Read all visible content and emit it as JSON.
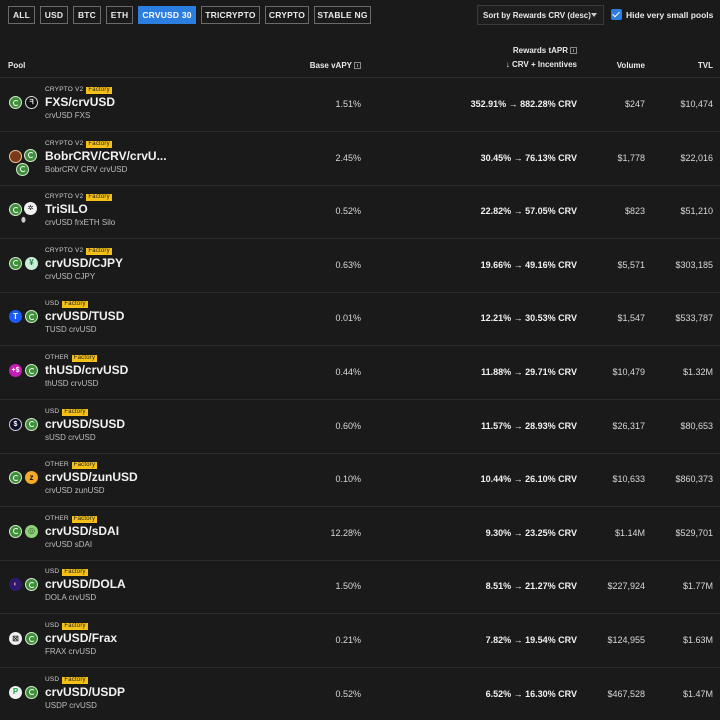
{
  "filters": [
    "ALL",
    "USD",
    "BTC",
    "ETH",
    "CRVUSD 30",
    "TRICRYPTO",
    "CRYPTO",
    "STABLE NG"
  ],
  "active_filter": "CRVUSD 30",
  "sort_label": "Sort by Rewards CRV (desc)",
  "hide_small_label": "Hide very small pools",
  "hide_small_checked": true,
  "headers": {
    "pool": "Pool",
    "base_vapy": "Base vAPY",
    "rewards_title": "Rewards tAPR",
    "rewards_sub": "↓ CRV + Incentives",
    "volume": "Volume",
    "tvl": "TVL"
  },
  "colors": {
    "accent": "#2b7de0",
    "factory_badge": "#f5c118",
    "background": "#1a1a1a"
  },
  "rows": [
    {
      "category": "CRYPTO V2",
      "badge": "Factory",
      "name": "FXS/crvUSD",
      "coins": "crvUSD FXS",
      "icons": [
        "crvusd-icon",
        "fxs-icon"
      ],
      "base_vapy": "1.51%",
      "rewards": "352.91% → 882.28% CRV",
      "volume": "$247",
      "tvl": "$10,474"
    },
    {
      "category": "CRYPTO V2",
      "badge": "Factory",
      "name": "BobrCRV/CRV/crvU...",
      "coins": "BobrCRV CRV crvUSD",
      "icons": [
        "bobrcrv-icon",
        "crv-icon",
        "crvusd-icon"
      ],
      "base_vapy": "2.45%",
      "rewards": "30.45% → 76.13% CRV",
      "volume": "$1,778",
      "tvl": "$22,016"
    },
    {
      "category": "CRYPTO V2",
      "badge": "Factory",
      "name": "TriSILO",
      "coins": "crvUSD frxETH Silo",
      "icons": [
        "crvusd-icon",
        "silo-icon",
        "frxeth-icon"
      ],
      "base_vapy": "0.52%",
      "rewards": "22.82% → 57.05% CRV",
      "volume": "$823",
      "tvl": "$51,210"
    },
    {
      "category": "CRYPTO V2",
      "badge": "Factory",
      "name": "crvUSD/CJPY",
      "coins": "crvUSD CJPY",
      "icons": [
        "crvusd-icon",
        "cjpy-icon"
      ],
      "base_vapy": "0.63%",
      "rewards": "19.66% → 49.16% CRV",
      "volume": "$5,571",
      "tvl": "$303,185"
    },
    {
      "category": "USD",
      "badge": "Factory",
      "name": "crvUSD/TUSD",
      "coins": "TUSD crvUSD",
      "icons": [
        "tusd-icon",
        "crvusd-icon"
      ],
      "base_vapy": "0.01%",
      "rewards": "12.21% → 30.53% CRV",
      "volume": "$1,547",
      "tvl": "$533,787"
    },
    {
      "category": "OTHER",
      "badge": "Factory",
      "name": "thUSD/crvUSD",
      "coins": "thUSD crvUSD",
      "icons": [
        "thusd-icon",
        "crvusd-icon"
      ],
      "base_vapy": "0.44%",
      "rewards": "11.88% → 29.71% CRV",
      "volume": "$10,479",
      "tvl": "$1.32M"
    },
    {
      "category": "USD",
      "badge": "Factory",
      "name": "crvUSD/SUSD",
      "coins": "sUSD crvUSD",
      "icons": [
        "susd-icon",
        "crvusd-icon"
      ],
      "base_vapy": "0.60%",
      "rewards": "11.57% → 28.93% CRV",
      "volume": "$26,317",
      "tvl": "$80,653"
    },
    {
      "category": "OTHER",
      "badge": "Factory",
      "name": "crvUSD/zunUSD",
      "coins": "crvUSD zunUSD",
      "icons": [
        "crvusd-icon",
        "zunusd-icon"
      ],
      "base_vapy": "0.10%",
      "rewards": "10.44% → 26.10% CRV",
      "volume": "$10,633",
      "tvl": "$860,373"
    },
    {
      "category": "OTHER",
      "badge": "Factory",
      "name": "crvUSD/sDAI",
      "coins": "crvUSD sDAI",
      "icons": [
        "crvusd-icon",
        "sdai-icon"
      ],
      "base_vapy": "12.28%",
      "rewards": "9.30% → 23.25% CRV",
      "volume": "$1.14M",
      "tvl": "$529,701"
    },
    {
      "category": "USD",
      "badge": "Factory",
      "name": "crvUSD/DOLA",
      "coins": "DOLA crvUSD",
      "icons": [
        "dola-icon",
        "crvusd-icon"
      ],
      "base_vapy": "1.50%",
      "rewards": "8.51% → 21.27% CRV",
      "volume": "$227,924",
      "tvl": "$1.77M"
    },
    {
      "category": "USD",
      "badge": "Factory",
      "name": "crvUSD/Frax",
      "coins": "FRAX crvUSD",
      "icons": [
        "frax-icon",
        "crvusd-icon"
      ],
      "base_vapy": "0.21%",
      "rewards": "7.82% → 19.54% CRV",
      "volume": "$124,955",
      "tvl": "$1.63M"
    },
    {
      "category": "USD",
      "badge": "Factory",
      "name": "crvUSD/USDP",
      "coins": "USDP crvUSD",
      "icons": [
        "usdp-icon",
        "crvusd-icon"
      ],
      "base_vapy": "0.52%",
      "rewards": "6.52% → 16.30% CRV",
      "volume": "$467,528",
      "tvl": "$1.47M"
    }
  ]
}
